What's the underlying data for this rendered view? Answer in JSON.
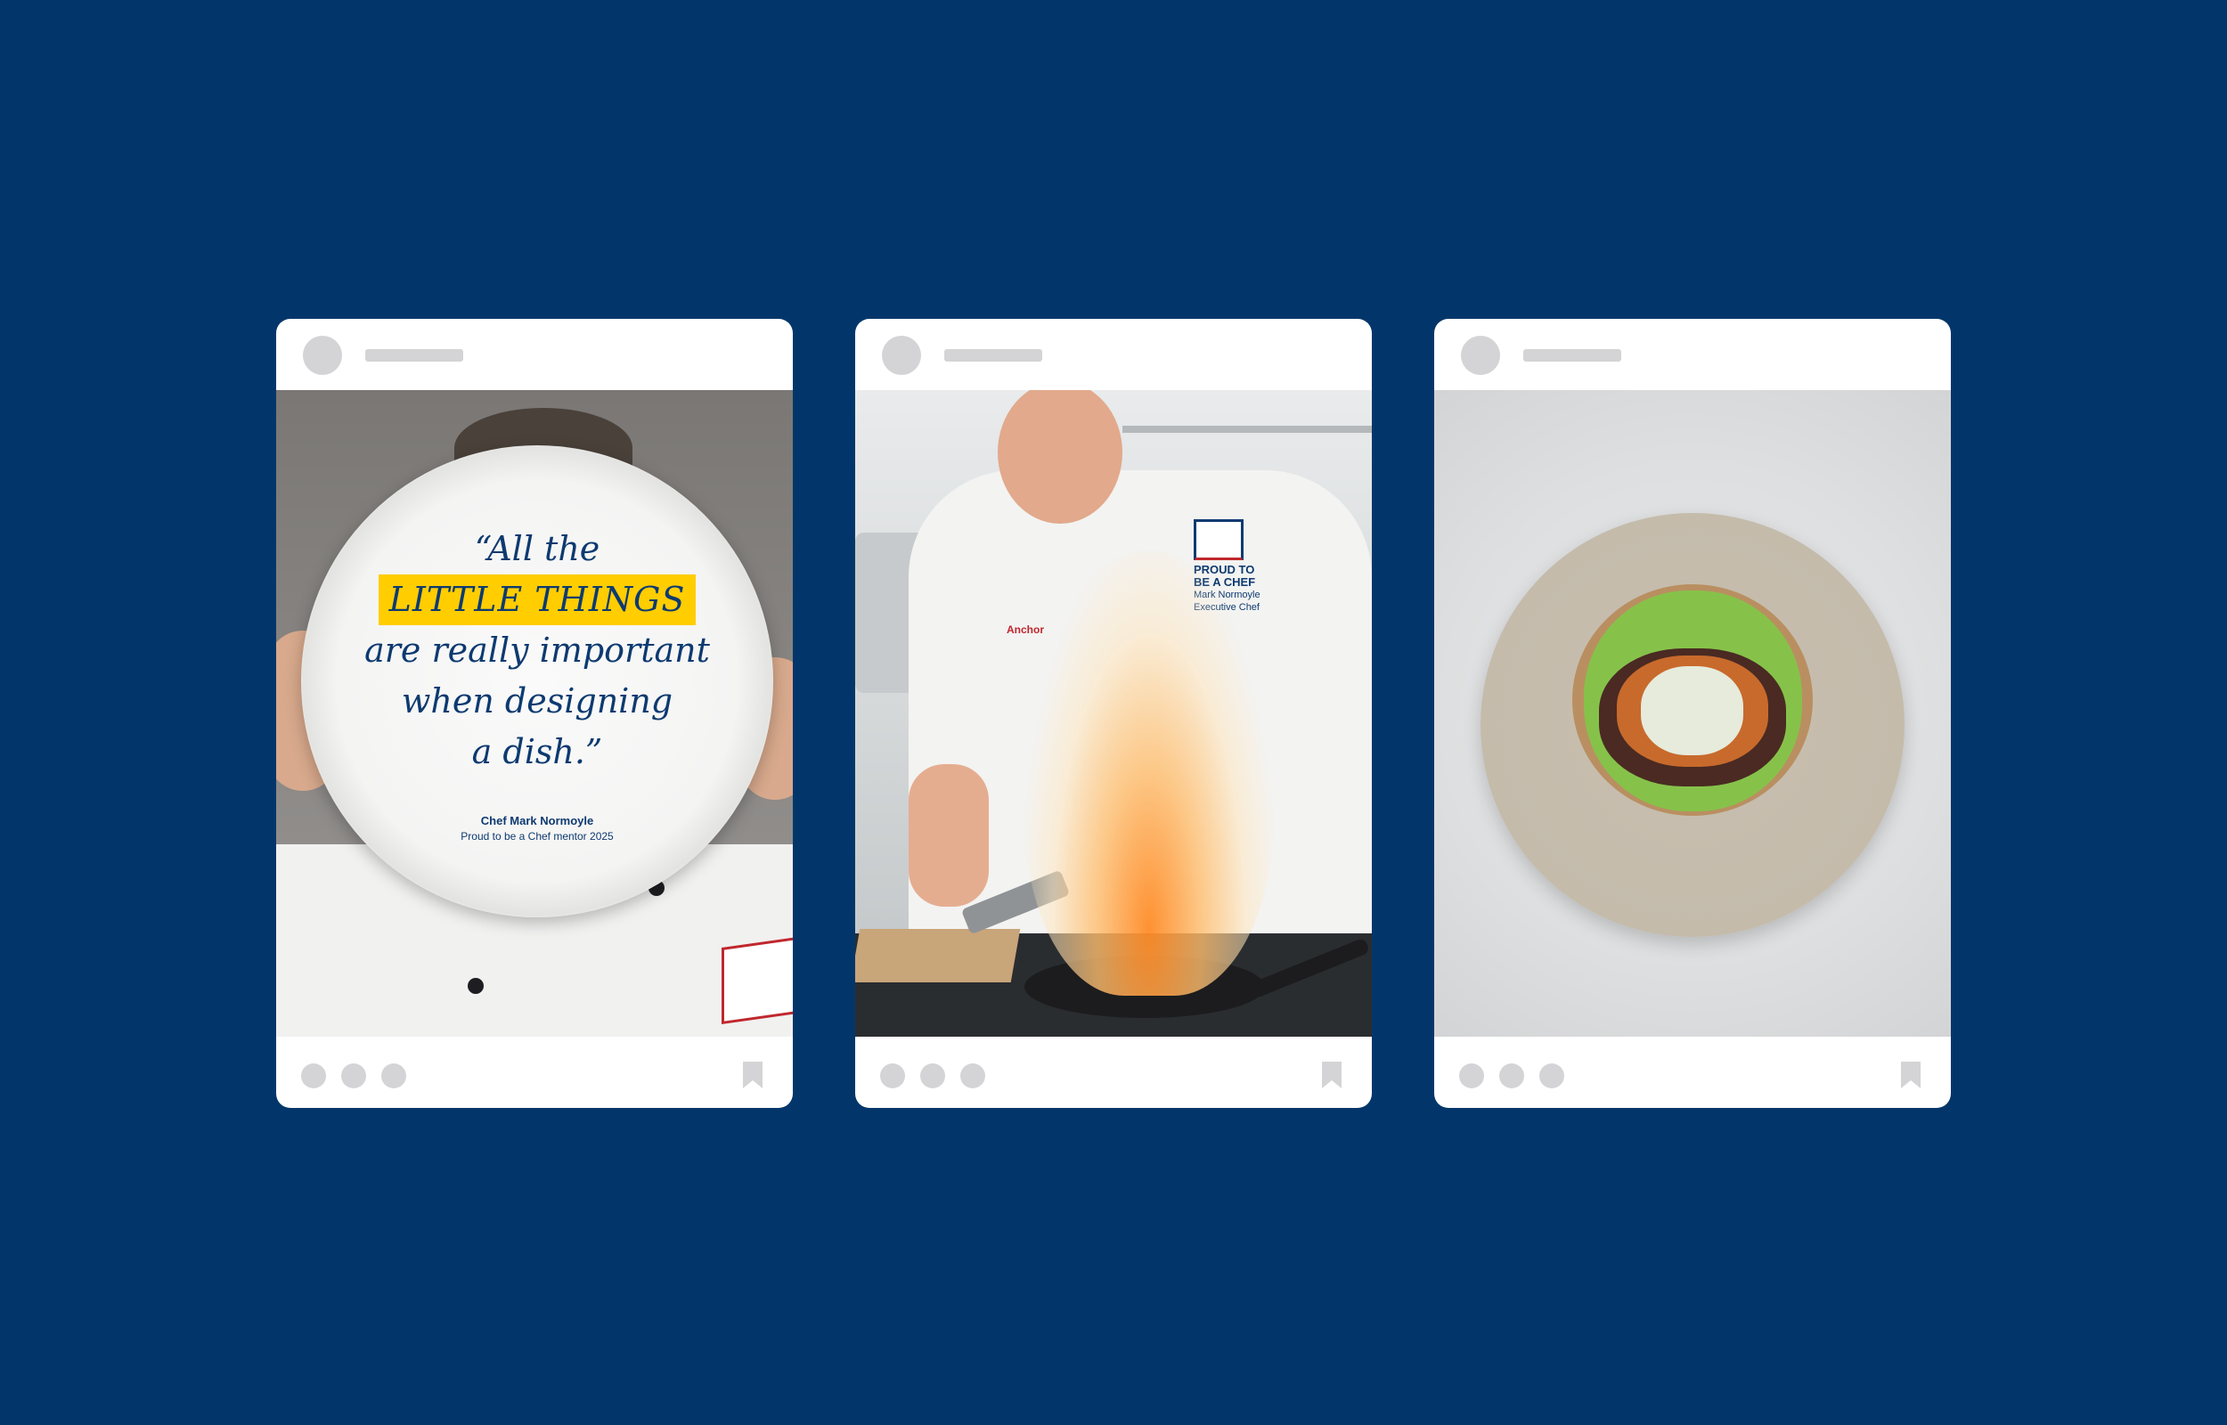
{
  "posts": [
    {
      "id_label": "post-1",
      "quote_line1": "“All the",
      "quote_highlight": "LITTLE THINGS",
      "quote_line3": "are really important",
      "quote_line4": "when designing",
      "quote_line5": "a dish.”",
      "signature_name": "Chef Mark Normoyle",
      "signature_role": "Proud to be a Chef mentor 2025"
    },
    {
      "id_label": "post-2",
      "jacket_logo_text": "PROUD TO BE A CHEF",
      "jacket_name_text": "Mark Normoyle Executive Chef",
      "sleeve_logo_text": "Anchor"
    },
    {
      "id_label": "post-3"
    }
  ],
  "colors": {
    "background": "#02366a",
    "card": "#ffffff",
    "placeholder": "#d4d4d6",
    "quote_text": "#0d3a70",
    "highlight": "#ffcd00"
  },
  "icons": {
    "avatar": "avatar-placeholder",
    "username": "username-placeholder-bar",
    "actions": [
      "like-icon",
      "comment-icon",
      "share-icon"
    ],
    "save": "bookmark-icon"
  }
}
